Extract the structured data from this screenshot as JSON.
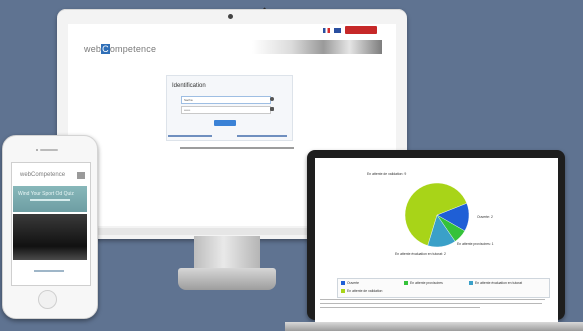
{
  "imac": {
    "logo": {
      "prefix": "web",
      "highlight": "C",
      "suffix": "ompetence"
    },
    "login": {
      "title": "Identification",
      "username_value": "Sacha",
      "password_value": "••••••"
    }
  },
  "phone": {
    "logo": "webCompetence",
    "hero_text": "Wind Your Sport Od Quiz"
  },
  "laptop": {
    "table": {
      "row1_col1": "Ouverte",
      "row1_col2": "En attente provisoires",
      "row1_col3": "En attente évaluation en tutorat",
      "row2_col1": "En attente de validation"
    }
  },
  "chart_data": {
    "type": "pie",
    "title": "",
    "categories": [
      "En attente de validation: 9",
      "Ouverte: 2",
      "En attente provisoires: 1",
      "En attente évaluation en tutorat: 2"
    ],
    "values": [
      9,
      2,
      1,
      2
    ],
    "colors": [
      "#a8d418",
      "#1f5fd6",
      "#35c23a",
      "#3aa0c8"
    ]
  }
}
